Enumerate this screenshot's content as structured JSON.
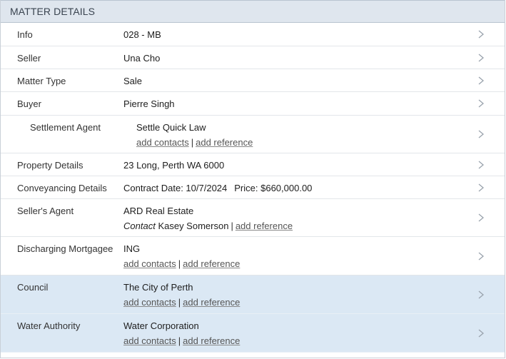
{
  "section": {
    "title": "MATTER DETAILS"
  },
  "rows": [
    {
      "label": "Info",
      "value": "028 - MB"
    },
    {
      "label": "Seller",
      "value": "Una Cho"
    },
    {
      "label": "Matter Type",
      "value": "Sale"
    },
    {
      "label": "Buyer",
      "value": "Pierre Singh"
    },
    {
      "label": "Settlement Agent",
      "value": "Settle Quick Law",
      "add_contacts": "add contacts",
      "sep": "|",
      "add_reference": "add reference"
    },
    {
      "label": "Property Details",
      "value": "23 Long, Perth WA 6000"
    },
    {
      "label": "Conveyancing Details",
      "contract": "Contract Date: 10/7/2024",
      "price": "Price: $660,000.00"
    },
    {
      "label": "Seller's Agent",
      "value": "ARD Real Estate",
      "contact_label": "Contact",
      "contact_name": "Kasey Somerson",
      "sep": "|",
      "add_reference": "add reference"
    },
    {
      "label": "Discharging Mortgagee",
      "value": "ING",
      "add_contacts": "add contacts",
      "sep": "|",
      "add_reference": "add reference"
    },
    {
      "label": "Council",
      "value": "The City of Perth",
      "add_contacts": "add contacts",
      "sep": "|",
      "add_reference": "add reference"
    },
    {
      "label": "Water Authority",
      "value": "Water Corporation",
      "add_contacts": "add contacts",
      "sep": "|",
      "add_reference": "add reference"
    }
  ],
  "icons": {
    "row_chevron": "chevron-right-icon"
  },
  "colors": {
    "header_bg": "#dfe6ee",
    "highlight_row_bg": "#dbe8f4",
    "chevron": "#9aa3ad"
  }
}
